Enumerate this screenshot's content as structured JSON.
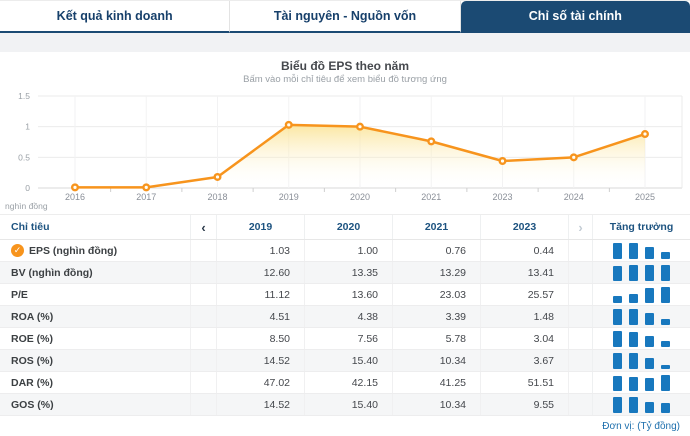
{
  "tabs": {
    "items": [
      {
        "label": "Kết quả kinh doanh",
        "active": false
      },
      {
        "label": "Tài nguyên - Nguồn vốn",
        "active": false
      },
      {
        "label": "Chỉ số tài chính",
        "active": true
      }
    ]
  },
  "chart": {
    "title": "Biểu đồ EPS theo năm",
    "subtitle": "Bấm vào mỗi chỉ tiêu để xem biểu đồ tương ứng",
    "y_unit": "nghìn đồng"
  },
  "chart_data": {
    "type": "area",
    "title": "Biểu đồ EPS theo năm",
    "x": [
      "2016",
      "2017",
      "2018",
      "2019",
      "2020",
      "2021",
      "2023",
      "2024",
      "2025"
    ],
    "series": [
      {
        "name": "EPS",
        "values": [
          0.01,
          0.01,
          0.18,
          1.03,
          1.0,
          0.76,
          0.44,
          0.5,
          0.88
        ]
      }
    ],
    "ylabel": "nghìn đồng",
    "xlabel": "",
    "ylim": [
      0,
      1.5
    ],
    "yticks": [
      0,
      0.5,
      1,
      1.5
    ],
    "grid": true,
    "legend": false,
    "line_color": "#f7941d",
    "marker_color": "#f7941d",
    "area_fill_top": "rgba(250,222,130,0.75)",
    "area_fill_bottom": "rgba(255,255,255,0)"
  },
  "table": {
    "header": {
      "metric": "Chỉ tiêu",
      "prev": "‹",
      "next": "›",
      "years": [
        "2019",
        "2020",
        "2021",
        "2023"
      ],
      "growth": "Tăng trưởng"
    },
    "rows": [
      {
        "label": "EPS (nghìn đồng)",
        "selected": true,
        "values": [
          "1.03",
          "1.00",
          "0.76",
          "0.44"
        ]
      },
      {
        "label": "BV (nghìn đồng)",
        "selected": false,
        "values": [
          "12.60",
          "13.35",
          "13.29",
          "13.41"
        ]
      },
      {
        "label": "P/E",
        "selected": false,
        "values": [
          "11.12",
          "13.60",
          "23.03",
          "25.57"
        ]
      },
      {
        "label": "ROA (%)",
        "selected": false,
        "values": [
          "4.51",
          "4.38",
          "3.39",
          "1.48"
        ]
      },
      {
        "label": "ROE (%)",
        "selected": false,
        "values": [
          "8.50",
          "7.56",
          "5.78",
          "3.04"
        ]
      },
      {
        "label": "ROS (%)",
        "selected": false,
        "values": [
          "14.52",
          "15.40",
          "10.34",
          "3.67"
        ]
      },
      {
        "label": "DAR (%)",
        "selected": false,
        "values": [
          "47.02",
          "42.15",
          "41.25",
          "51.51"
        ]
      },
      {
        "label": "GOS (%)",
        "selected": false,
        "values": [
          "14.52",
          "15.40",
          "10.34",
          "9.55"
        ]
      }
    ]
  },
  "footer": {
    "unit_note": "Đơn vị: (Tỷ đồng)"
  },
  "colors": {
    "navy": "#1b4a73",
    "bar_blue": "#1878be",
    "line_orange": "#f7941d",
    "header_text": "#1d5380",
    "note_blue": "#1d6fad"
  },
  "icons": {
    "check": "✓",
    "chevron_left": "‹",
    "chevron_right": "›"
  }
}
